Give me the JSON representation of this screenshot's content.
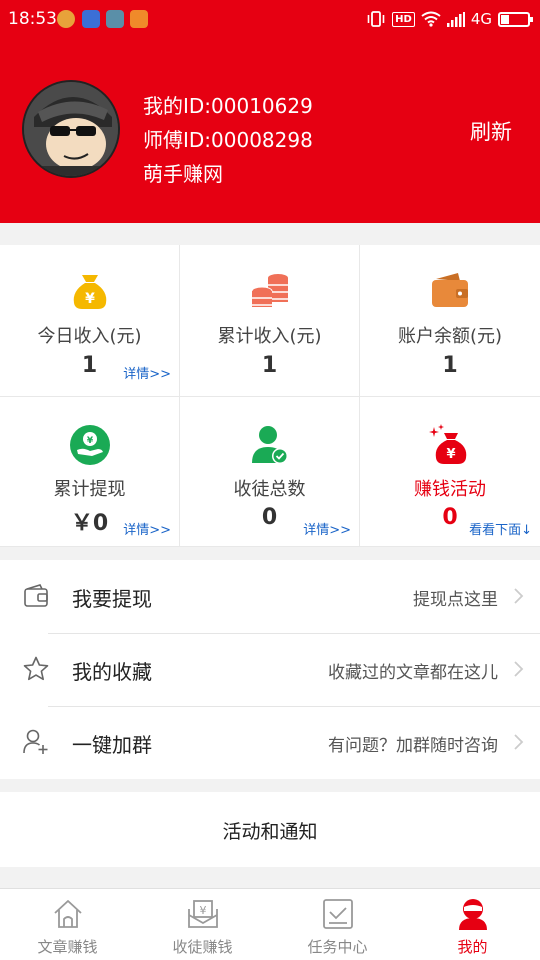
{
  "status_bar": {
    "time": "18:53",
    "network": "4G",
    "hd_label": "HD"
  },
  "profile": {
    "my_id": "我的ID:00010629",
    "master_id": "师傅ID:00008298",
    "site_name": "萌手赚网",
    "refresh_label": "刷新"
  },
  "stats": [
    {
      "label": "今日收入(元)",
      "value": "1",
      "more": "详情>>",
      "icon": "money-bag-icon"
    },
    {
      "label": "累计收入(元)",
      "value": "1",
      "more": "",
      "icon": "coin-stack-icon"
    },
    {
      "label": "账户余额(元)",
      "value": "1",
      "more": "",
      "icon": "wallet-icon"
    },
    {
      "label": "累计提现",
      "value": "￥0",
      "more": "详情>>",
      "icon": "withdraw-icon"
    },
    {
      "label": "收徒总数",
      "value": "0",
      "more": "详情>>",
      "icon": "user-check-icon"
    },
    {
      "label": "赚钱活动",
      "value": "0",
      "more": "看看下面↓",
      "icon": "sparkle-bag-icon"
    }
  ],
  "menu": [
    {
      "title": "我要提现",
      "hint": "提现点这里",
      "icon": "wallet-outline-icon"
    },
    {
      "title": "我的收藏",
      "hint": "收藏过的文章都在这儿",
      "icon": "star-icon"
    },
    {
      "title": "一键加群",
      "hint": "有问题？加群随时咨询",
      "icon": "add-user-icon"
    }
  ],
  "activity_title": "活动和通知",
  "tabs": [
    {
      "label": "文章赚钱",
      "icon": "home-icon",
      "active": false
    },
    {
      "label": "收徒赚钱",
      "icon": "envelope-yen-icon",
      "active": false
    },
    {
      "label": "任务中心",
      "icon": "task-check-icon",
      "active": false
    },
    {
      "label": "我的",
      "icon": "user-icon",
      "active": true
    }
  ],
  "colors": {
    "brand_red": "#e60012",
    "link_blue": "#1a64c8",
    "green": "#1aaa55",
    "gold": "#f5b800",
    "coral": "#f07058",
    "orange": "#e8893a"
  }
}
